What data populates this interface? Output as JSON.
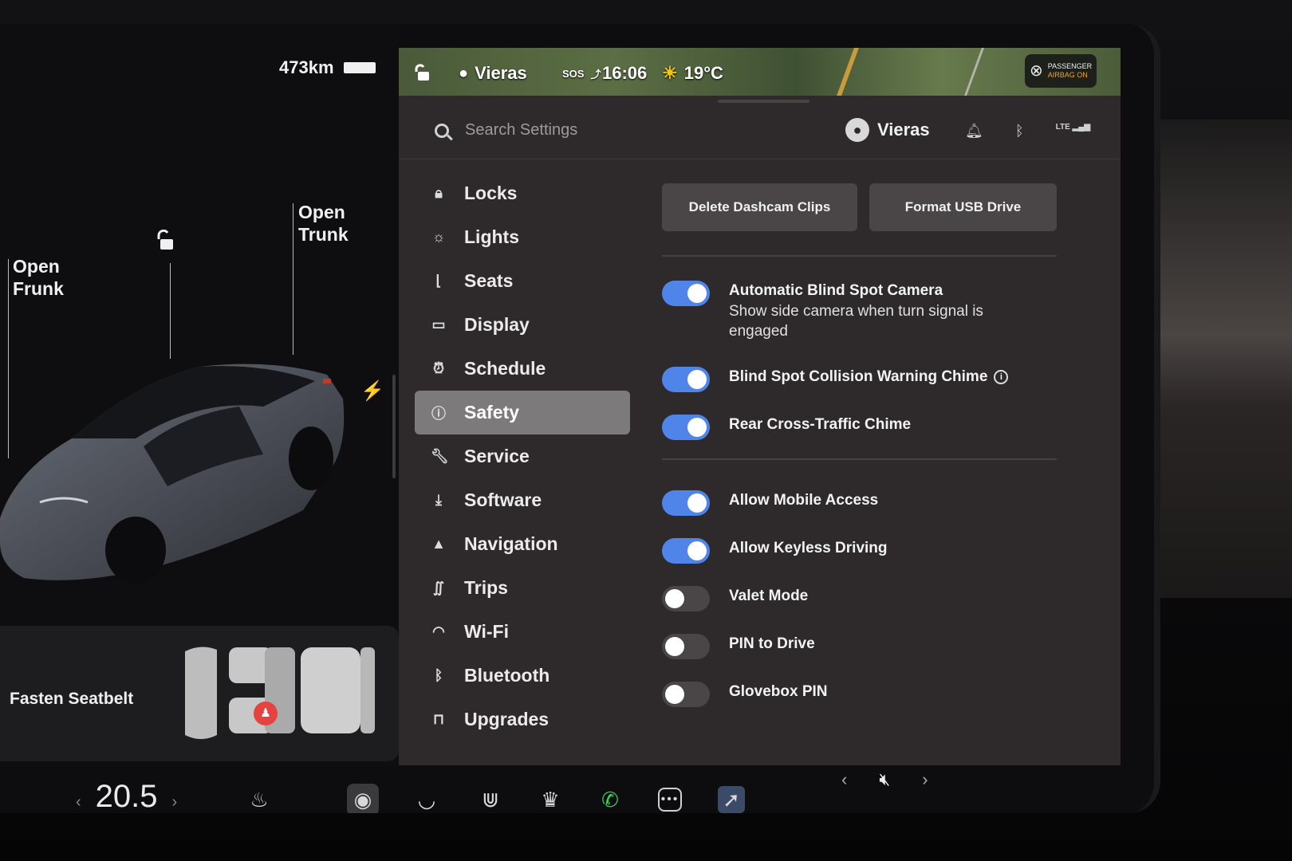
{
  "status": {
    "range": "473km",
    "profile_name": "Vieras",
    "sos": "SOS",
    "time": "16:06",
    "temperature": "19°C",
    "airbag_line1": "PASSENGER",
    "airbag_line2": "AIRBAG ON"
  },
  "car": {
    "open_frunk": [
      "Open",
      "Frunk"
    ],
    "open_trunk": [
      "Open",
      "Trunk"
    ],
    "seatbelt_warning": "Fasten Seatbelt"
  },
  "header": {
    "search_placeholder": "Search Settings",
    "user_name": "Vieras",
    "lte": "LTE"
  },
  "nav": {
    "items": [
      {
        "label": "Locks",
        "icon": "lock-icon"
      },
      {
        "label": "Lights",
        "icon": "sun-icon"
      },
      {
        "label": "Seats",
        "icon": "seat-icon"
      },
      {
        "label": "Display",
        "icon": "display-icon"
      },
      {
        "label": "Schedule",
        "icon": "alarm-clock-icon"
      },
      {
        "label": "Safety",
        "icon": "warning-icon",
        "active": true
      },
      {
        "label": "Service",
        "icon": "wrench-icon"
      },
      {
        "label": "Software",
        "icon": "download-icon"
      },
      {
        "label": "Navigation",
        "icon": "navigation-arrow-icon"
      },
      {
        "label": "Trips",
        "icon": "trips-icon"
      },
      {
        "label": "Wi-Fi",
        "icon": "wifi-icon"
      },
      {
        "label": "Bluetooth",
        "icon": "bluetooth-icon"
      },
      {
        "label": "Upgrades",
        "icon": "shopping-bag-icon"
      }
    ]
  },
  "safety": {
    "delete_dashcam": "Delete Dashcam Clips",
    "format_usb": "Format USB Drive",
    "settings": [
      {
        "title": "Automatic Blind Spot Camera",
        "subtitle": "Show side camera when turn signal is engaged",
        "on": true
      },
      {
        "title": "Blind Spot Collision Warning Chime",
        "subtitle": "",
        "on": true
      },
      {
        "title": "Rear Cross-Traffic Chime",
        "subtitle": "",
        "on": true
      },
      {
        "title": "Allow Mobile Access",
        "subtitle": "",
        "on": true
      },
      {
        "title": "Allow Keyless Driving",
        "subtitle": "",
        "on": true
      },
      {
        "title": "Valet Mode",
        "subtitle": "",
        "on": false
      },
      {
        "title": "PIN to Drive",
        "subtitle": "",
        "on": false
      },
      {
        "title": "Glovebox PIN",
        "subtitle": "",
        "on": false
      }
    ]
  },
  "dock": {
    "cabin_temp": "20.5"
  },
  "colors": {
    "toggle_on": "#4f84e8",
    "phone_green": "#3ccf5a",
    "alert_red": "#e4433f"
  }
}
